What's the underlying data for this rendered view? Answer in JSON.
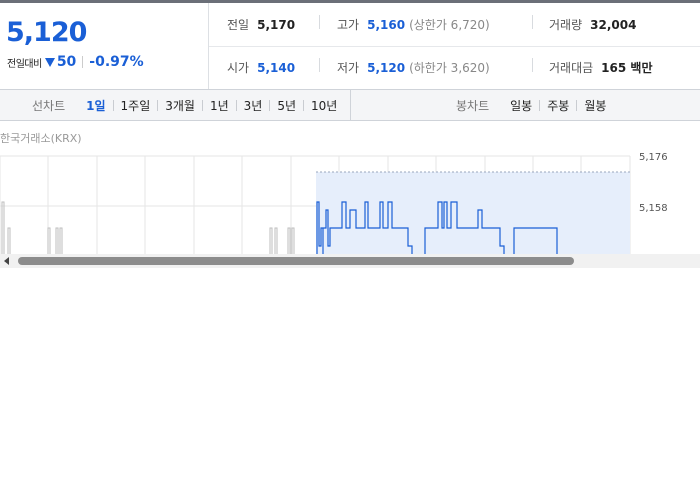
{
  "quote": {
    "price": "5,120",
    "change_label": "전일대비",
    "change_value": "50",
    "change_rate": "-0.97%",
    "stats": {
      "prev_close": {
        "label": "전일",
        "value": "5,170"
      },
      "high": {
        "label": "고가",
        "value": "5,160",
        "sub": "(상한가 6,720)"
      },
      "volume": {
        "label": "거래량",
        "value": "32,004"
      },
      "open": {
        "label": "시가",
        "value": "5,140"
      },
      "low": {
        "label": "저가",
        "value": "5,120",
        "sub": "(하한가 3,620)"
      },
      "amount": {
        "label": "거래대금",
        "value": "165 백만"
      }
    }
  },
  "tabs": {
    "line_title": "선차트",
    "line_periods": [
      "1일",
      "1주일",
      "3개월",
      "1년",
      "3년",
      "5년",
      "10년"
    ],
    "active_line": "1일",
    "candle_title": "봉차트",
    "candle_periods": [
      "일봉",
      "주봉",
      "월봉"
    ]
  },
  "chart": {
    "source": "한국거래소(KRX)",
    "y_ticks": [
      "5,176",
      "5,158"
    ],
    "colors": {
      "line": "#1a5fd6",
      "fill": "#e6eefb",
      "grid": "#e5e5e5",
      "prev_line": "#bdbdbd"
    }
  }
}
